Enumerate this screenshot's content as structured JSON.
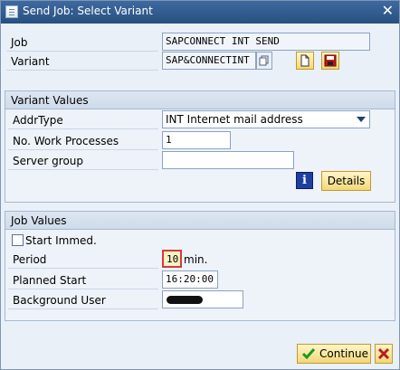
{
  "window": {
    "title": "Send Job: Select Variant"
  },
  "header": {
    "job_label": "Job",
    "job_value": "SAPCONNECT INT SEND",
    "variant_label": "Variant",
    "variant_value": "SAP&CONNECTINT"
  },
  "variant_values": {
    "title": "Variant Values",
    "addr_type_label": "AddrType",
    "addr_type_value": "INT Internet mail address",
    "work_processes_label": "No. Work Processes",
    "work_processes_value": "1",
    "server_group_label": "Server group",
    "server_group_value": "",
    "details_label": "Details"
  },
  "job_values": {
    "title": "Job Values",
    "start_immed_label": "Start Immed.",
    "start_immed_checked": false,
    "period_label": "Period",
    "period_value": "10",
    "period_unit": "min.",
    "planned_start_label": "Planned Start",
    "planned_start_value": "16:20:00",
    "background_user_label": "Background User",
    "background_user_value": ""
  },
  "footer": {
    "continue_label": "Continue"
  },
  "colors": {
    "title_bar": "#2f5b8f",
    "button_fill": "#f2d779",
    "cancel_red": "#c0181a",
    "continue_green": "#1b9a1b"
  }
}
